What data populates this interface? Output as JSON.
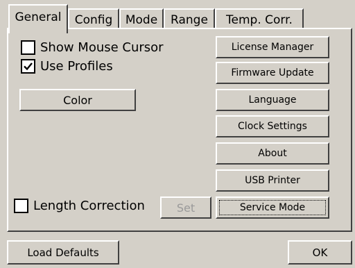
{
  "tabs": [
    {
      "label": "General",
      "active": true
    },
    {
      "label": "Config",
      "active": false
    },
    {
      "label": "Mode",
      "active": false
    },
    {
      "label": "Range",
      "active": false
    },
    {
      "label": "Temp. Corr.",
      "active": false
    }
  ],
  "general": {
    "show_mouse_cursor": {
      "label": "Show Mouse Cursor",
      "checked": false
    },
    "use_profiles": {
      "label": "Use Profiles",
      "checked": true
    },
    "color_button": "Color",
    "length_correction": {
      "label": "Length Correction",
      "checked": false
    },
    "set_button": "Set",
    "right_buttons": {
      "license_manager": "License Manager",
      "firmware_update": "Firmware Update",
      "language": "Language",
      "clock_settings": "Clock Settings",
      "about": "About",
      "usb_printer": "USB Printer",
      "service_mode": "Service Mode"
    }
  },
  "footer": {
    "load_defaults": "Load Defaults",
    "ok": "OK"
  },
  "colors": {
    "face": "#d4d0c8",
    "highlight": "#ffffff",
    "shadow": "#404040",
    "disabled_text": "#9a9a9a"
  }
}
